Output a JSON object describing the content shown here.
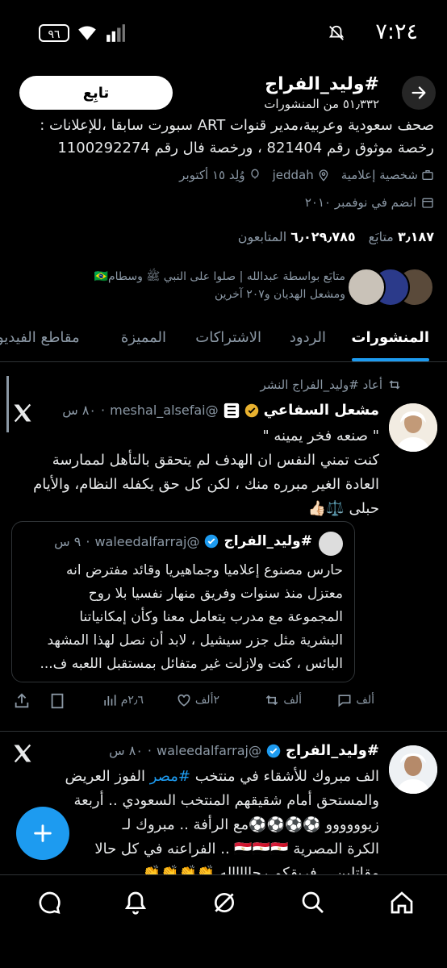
{
  "status_bar": {
    "time": "٧:٢٤",
    "battery": "٩٦"
  },
  "header": {
    "name": "#وليد_الفراج",
    "posts_count": "٥١٫٣٣٢ من المنشورات",
    "follow_label": "تابِع"
  },
  "profile": {
    "bio_line1": "صحف سعودية وعربية،مدير قنوات ART سبورت سابقا ،للإعلانات :",
    "bio_line2": "رخصة موثوق رقم 821404 ، ورخصة فال رقم 1100292274",
    "category": "شخصية إعلامية",
    "location": "jeddah",
    "birthday": "وُلِد ١٥ أكتوبر",
    "joined": "انضم في نوفمبر ٢٠١٠",
    "following_num": "٣٫١٨٧",
    "following_label": "متابَع",
    "followers_num": "٦٫٠٢٩٫٧٨٥",
    "followers_label": "المتابعون",
    "followed_by_line1": "متابَع بواسطة عبدالله | صلوا على النبي ﷺ وسطام🇧🇷",
    "followed_by_line2": "ومشعل الهديان و٢٠٧ آخرين"
  },
  "tabs": [
    "المنشورات",
    "الردود",
    "الاشتراكات",
    "المميزة",
    "مقاطع الفيديو"
  ],
  "post1": {
    "repost_label": "أعاد #وليد_الفراج النشر",
    "name": "مشعل السفاعي",
    "handle": "@meshal_alsefai",
    "time": "٨٠ س",
    "line1": "\" صنعه فخر يمينه \"",
    "line2": "كنت تمني النفس ان الهدف لم يتحقق بالتأهل لممارسة",
    "line3": "العادة الغير مبرره منك ، لكن كل حق يكفله النظام، والأيام",
    "line4": "حبلى ⚖️👍🏻",
    "quote": {
      "name": "#وليد_الفراج",
      "handle": "@waleedalfarraj",
      "time": "٩ س",
      "line1": "حارس مصنوع إعلاميا وجماهيريا وقائد مفترض انه",
      "line2": "معتزل منذ سنوات وفريق منهار نفسيا بلا روح",
      "line3": "المجموعة مع مدرب يتعامل معنا وكأن إمكانياتنا",
      "line4": "البشرية مثل جزر سيشيل ، لابد أن نصل لهذا المشهد",
      "line5": "البائس ، كنت ولازلت غير متفائل بمستقبل اللعبه ف..."
    },
    "replies": "ألف",
    "reposts": "ألف",
    "likes": "٢ألف",
    "views": "٢٫٦م"
  },
  "post2": {
    "name": "#وليد_الفراج",
    "handle": "@waleedalfarraj",
    "time": "٨٠ س",
    "line1_pre": "الف مبروك للأشقاء في منتخب ",
    "line1_link": "#مصر",
    "line1_post": " الفوز العريض",
    "line2": "والمستحق أمام شقيقهم المنتخب السعودي .. أربعة",
    "line3": "زيوووووو ⚽⚽⚽⚽مع الرأفة .. مبروك لـ",
    "line4": "الكرة المصرية 🇪🇬🇪🇬🇪🇬 .. الفراعنه في كل حالا",
    "line5": "مقاتلين .. فريقكم رجاااااله 👏👏👏👏"
  },
  "colors": {
    "accent": "#1d9bf0",
    "verified_gold": "#e8b12f",
    "muted": "#8b98a5"
  }
}
